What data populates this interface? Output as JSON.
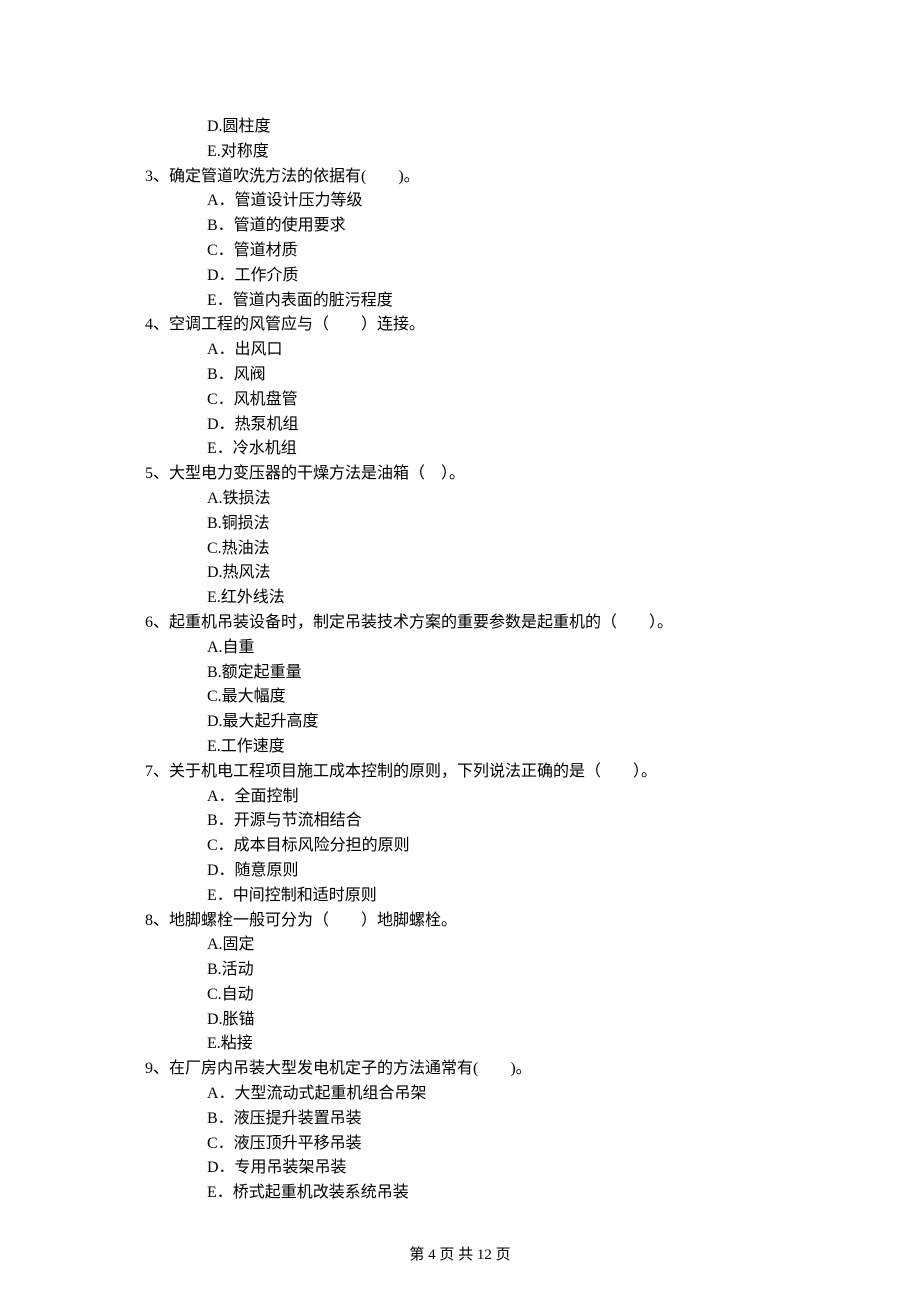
{
  "prev_options": [
    "D.圆柱度",
    "E.对称度"
  ],
  "questions": [
    {
      "stem": "3、确定管道吹洗方法的依据有(　　)。",
      "options": [
        "A．管道设计压力等级",
        "B．管道的使用要求",
        "C．管道材质",
        "D．工作介质",
        "E．管道内表面的脏污程度"
      ]
    },
    {
      "stem": "4、空调工程的风管应与（　　）连接。",
      "options": [
        "A．出风口",
        "B．风阀",
        "C．风机盘管",
        "D．热泵机组",
        "E．冷水机组"
      ]
    },
    {
      "stem": "5、大型电力变压器的干燥方法是油箱（　）。",
      "options": [
        "A.铁损法",
        "B.铜损法",
        "C.热油法",
        "D.热风法",
        "E.红外线法"
      ]
    },
    {
      "stem": "6、起重机吊装设备时，制定吊装技术方案的重要参数是起重机的（　　）。",
      "options": [
        "A.自重",
        "B.额定起重量",
        "C.最大幅度",
        "D.最大起升高度",
        "E.工作速度"
      ]
    },
    {
      "stem": "7、关于机电工程项目施工成本控制的原则，下列说法正确的是（　　）。",
      "options": [
        "A．全面控制",
        "B．开源与节流相结合",
        "C．成本目标风险分担的原则",
        "D．随意原则",
        "E．中间控制和适时原则"
      ]
    },
    {
      "stem": "8、地脚螺栓一般可分为（　　）地脚螺栓。",
      "options": [
        "A.固定",
        "B.活动",
        "C.自动",
        "D.胀锚",
        "E.粘接"
      ]
    },
    {
      "stem": "9、在厂房内吊装大型发电机定子的方法通常有(　　)。",
      "options": [
        "A．大型流动式起重机组合吊架",
        "B．液压提升装置吊装",
        "C．液压顶升平移吊装",
        "D．专用吊装架吊装",
        "E．桥式起重机改装系统吊装"
      ]
    }
  ],
  "footer": "第 4 页 共 12 页"
}
